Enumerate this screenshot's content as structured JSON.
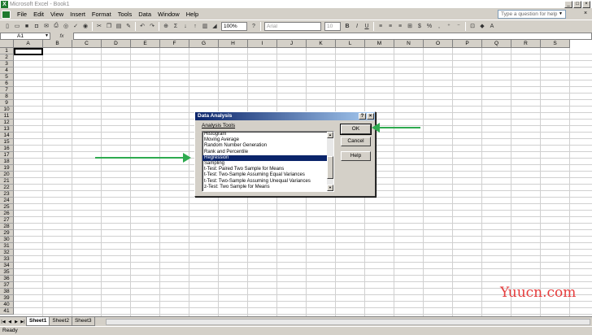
{
  "window": {
    "title": "Microsoft Excel - Book1"
  },
  "menu": {
    "items": [
      "File",
      "Edit",
      "View",
      "Insert",
      "Format",
      "Tools",
      "Data",
      "Window",
      "Help"
    ],
    "ask_placeholder": "Type a question for help"
  },
  "toolbar": {
    "zoom": "100%",
    "font": "Arial",
    "font_size": "10"
  },
  "formula_bar": {
    "name_box": "A1",
    "fx": "fx"
  },
  "columns": [
    "A",
    "B",
    "C",
    "D",
    "E",
    "F",
    "G",
    "H",
    "I",
    "J",
    "K",
    "L",
    "M",
    "N",
    "O",
    "P",
    "Q",
    "R",
    "S"
  ],
  "rows": [
    "1",
    "2",
    "3",
    "4",
    "5",
    "6",
    "7",
    "8",
    "9",
    "10",
    "11",
    "12",
    "13",
    "14",
    "15",
    "16",
    "17",
    "18",
    "19",
    "20",
    "21",
    "22",
    "23",
    "24",
    "25",
    "26",
    "27",
    "28",
    "29",
    "30",
    "31",
    "32",
    "33",
    "34",
    "35",
    "36",
    "37",
    "38",
    "39",
    "40",
    "41"
  ],
  "sheets": [
    "Sheet1",
    "Sheet2",
    "Sheet3"
  ],
  "active_sheet": "Sheet1",
  "status": "Ready",
  "dialog": {
    "title": "Data Analysis",
    "help_btn": "?",
    "close_btn": "×",
    "label": "Analysis Tools",
    "items": [
      "Histogram",
      "Moving Average",
      "Random Number Generation",
      "Rank and Percentile",
      "Regression",
      "Sampling",
      "t-Test: Paired Two Sample for Means",
      "t-Test: Two-Sample Assuming Equal Variances",
      "t-Test: Two-Sample Assuming Unequal Variances",
      "z-Test: Two Sample for Means"
    ],
    "selected_index": 4,
    "ok_label": "OK",
    "cancel_label": "Cancel",
    "help_label": "Help"
  },
  "watermark": "Yuucn.com",
  "colors": {
    "arrow": "#2eaa4f",
    "selection": "#0a246a",
    "watermark": "#e53c3c"
  }
}
